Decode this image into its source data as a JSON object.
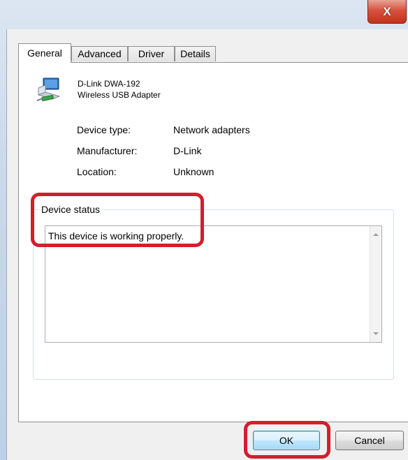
{
  "window": {
    "close_glyph": "X"
  },
  "tabs": [
    {
      "label": "General",
      "active": true
    },
    {
      "label": "Advanced",
      "active": false
    },
    {
      "label": "Driver",
      "active": false
    },
    {
      "label": "Details",
      "active": false
    }
  ],
  "device": {
    "icon": "network-adapter-icon",
    "name_line1": "D-Link DWA-192",
    "name_line2": "Wireless USB Adapter"
  },
  "properties": [
    {
      "label": "Device type:",
      "value": "Network adapters"
    },
    {
      "label": "Manufacturer:",
      "value": "D-Link"
    },
    {
      "label": "Location:",
      "value": "Unknown"
    }
  ],
  "status": {
    "legend": "Device status",
    "text": "This device is working properly."
  },
  "buttons": {
    "ok": "OK",
    "cancel": "Cancel"
  },
  "colors": {
    "highlight": "#d21f2b",
    "close_button": "#d7523e",
    "default_button": "#a7d9f5"
  }
}
